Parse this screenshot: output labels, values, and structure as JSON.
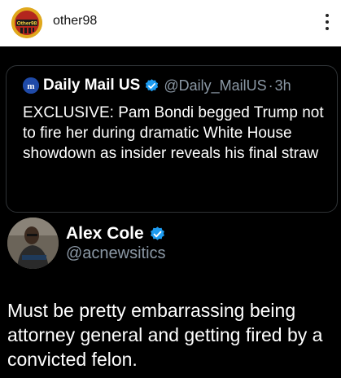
{
  "header": {
    "username": "other98",
    "avatar_icon": "other98-logo-icon",
    "menu_icon": "vertical-dots-icon"
  },
  "quoted_post": {
    "logo_icon": "daily-mail-logo-icon",
    "name": "Daily Mail US",
    "verified_icon": "verified-badge-icon",
    "handle": "@Daily_MailUS",
    "separator": "·",
    "time": "3h",
    "text": "EXCLUSIVE: Pam Bondi begged Trump not to fire her during dramatic White House showdown as insider reveals his final straw"
  },
  "post": {
    "author_name": "Alex Cole",
    "author_handle": "@acnewsitics",
    "text": "Must be pretty embarrassing being attorney general and getting fired by a convicted felon.",
    "verified_icon": "verified-badge-icon"
  },
  "colors": {
    "background": "#000000",
    "top_bar": "#ffffff",
    "verified_blue": "#1d9bf0",
    "secondary_text": "#8b98a5",
    "card_border": "#2f3336"
  }
}
